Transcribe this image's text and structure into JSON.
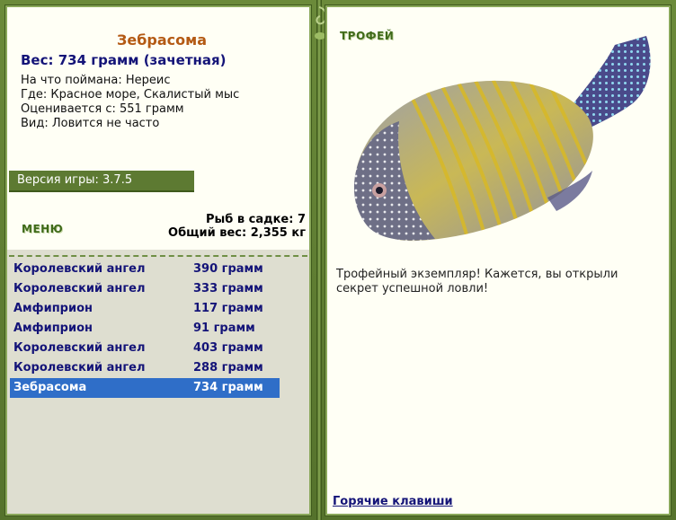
{
  "fish": {
    "name": "Зебрасома",
    "weight_line": "Вес: 734 грамм (зачетная)",
    "bait": "На что поймана: Нереис",
    "location": "Где: Красное море, Скалистый мыс",
    "valued_from": "Оценивается с: 551 грамм",
    "kind": "Вид: Ловится не часто"
  },
  "version": "Версия игры: 3.7.5",
  "menu_label": "МЕНЮ",
  "stats": {
    "fish_in_net": "Рыб в садке: 7",
    "total_weight": "Общий вес: 2,355 кг"
  },
  "catch_list": [
    {
      "name": "Королевский ангел",
      "weight": "390 грамм"
    },
    {
      "name": "Королевский ангел",
      "weight": "333 грамм"
    },
    {
      "name": "Амфиприон",
      "weight": "117 грамм"
    },
    {
      "name": "Амфиприон",
      "weight": "91 грамм"
    },
    {
      "name": "Королевский ангел",
      "weight": "403 грамм"
    },
    {
      "name": "Королевский ангел",
      "weight": "288 грамм"
    },
    {
      "name": "Зебрасома",
      "weight": "734 грамм",
      "selected": true
    }
  ],
  "trophy": {
    "label": "ТРОФЕЙ",
    "text": "Трофейный экземпляр! Кажется, вы открыли секрет успешной ловли!"
  },
  "hotkeys": "Горячие клавиши",
  "colors": {
    "frame": "#5d7a32",
    "panel_bg": "#fffff5",
    "list_bg": "#deded0",
    "selected_row": "#2f6ec8",
    "title": "#b45a14",
    "link": "#141478"
  }
}
